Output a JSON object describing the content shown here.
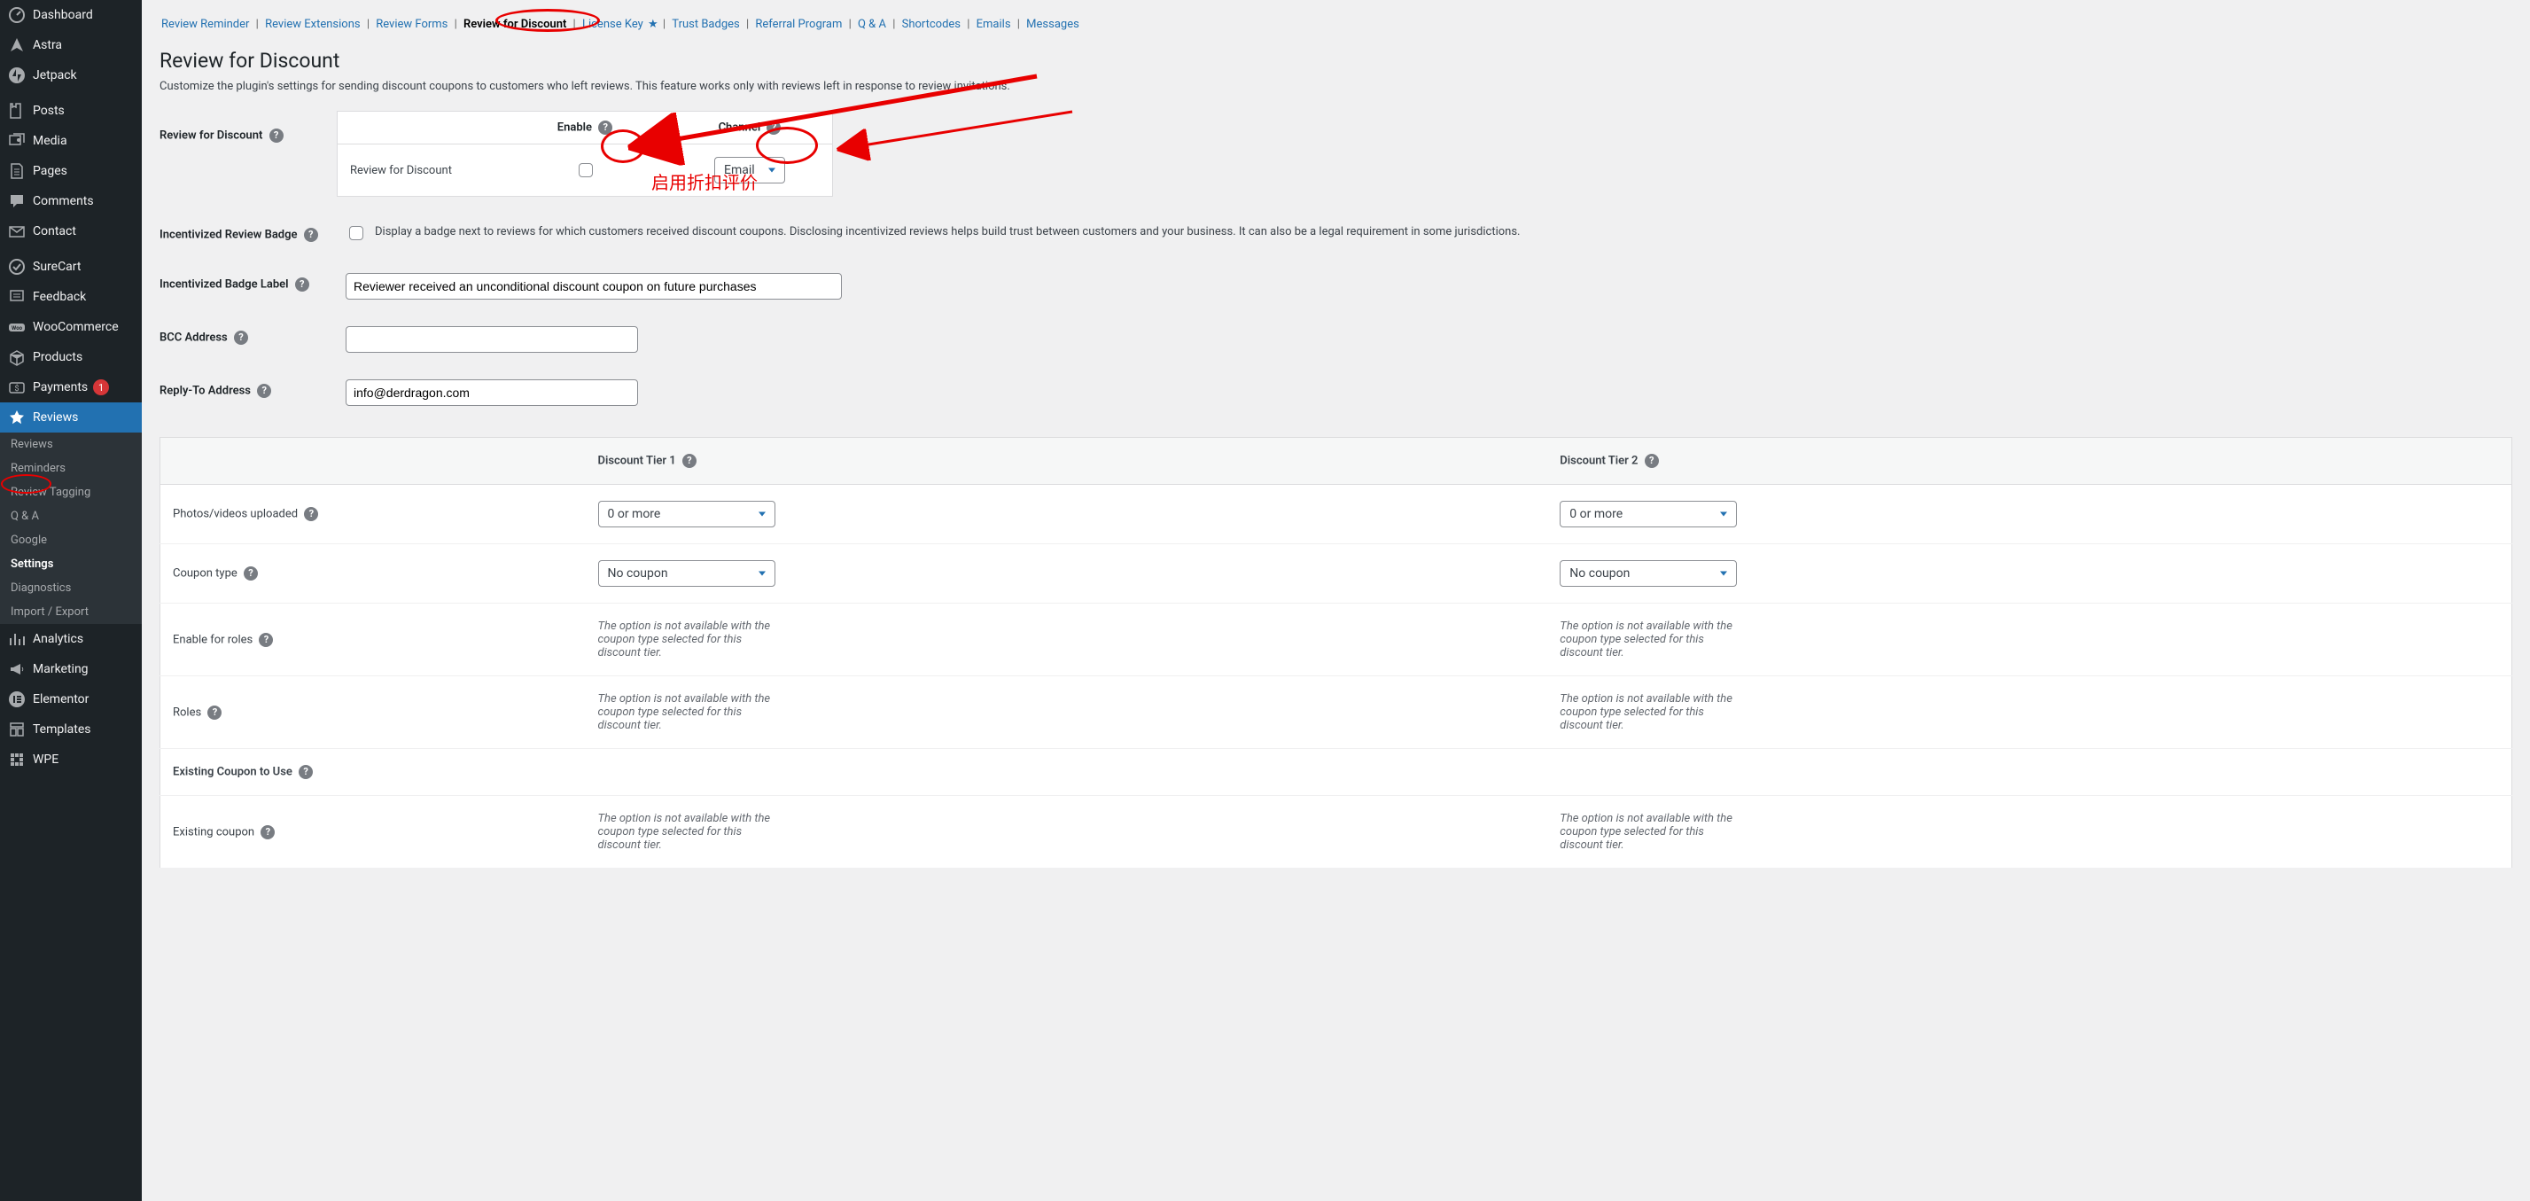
{
  "sidebar": {
    "items": [
      {
        "icon": "dashboard",
        "label": "Dashboard"
      },
      {
        "icon": "astra",
        "label": "Astra"
      },
      {
        "icon": "jetpack",
        "label": "Jetpack"
      },
      {
        "icon": "posts",
        "label": "Posts"
      },
      {
        "icon": "media",
        "label": "Media"
      },
      {
        "icon": "pages",
        "label": "Pages"
      },
      {
        "icon": "comments",
        "label": "Comments"
      },
      {
        "icon": "contact",
        "label": "Contact"
      },
      {
        "icon": "surecart",
        "label": "SureCart"
      },
      {
        "icon": "feedback",
        "label": "Feedback"
      },
      {
        "icon": "woo",
        "label": "WooCommerce"
      },
      {
        "icon": "products",
        "label": "Products"
      },
      {
        "icon": "payments",
        "label": "Payments",
        "badge": "1"
      },
      {
        "icon": "reviews",
        "label": "Reviews",
        "active": true
      },
      {
        "icon": "analytics",
        "label": "Analytics"
      },
      {
        "icon": "marketing",
        "label": "Marketing"
      },
      {
        "icon": "elementor",
        "label": "Elementor"
      },
      {
        "icon": "templates",
        "label": "Templates"
      },
      {
        "icon": "wpe",
        "label": "WPE"
      }
    ],
    "sub": [
      "Reviews",
      "Reminders",
      "Review Tagging",
      "Q & A",
      "Google",
      "Settings",
      "Diagnostics",
      "Import / Export"
    ],
    "sub_current": "Settings"
  },
  "tabs": [
    "Review Reminder",
    "Review Extensions",
    "Review Forms",
    "Review for Discount",
    "License Key",
    "Trust Badges",
    "Referral Program",
    "Q & A",
    "Shortcodes",
    "Emails",
    "Messages"
  ],
  "tabs_active": "Review for Discount",
  "tabs_star": "License Key",
  "page": {
    "title": "Review for Discount",
    "desc": "Customize the plugin's settings for sending discount coupons to customers who left reviews. This feature works only with reviews left in response to review invitations."
  },
  "row_rfd": {
    "label": "Review for Discount",
    "col_enable": "Enable",
    "col_channel": "Channel",
    "inner_label": "Review for Discount",
    "channel_value": "Email"
  },
  "row_badge": {
    "label": "Incentivized Review Badge",
    "checkbox_label": "Display a badge next to reviews for which customers received discount coupons. Disclosing incentivized reviews helps build trust between customers and your business. It can also be a legal requirement in some jurisdictions."
  },
  "row_badge_label": {
    "label": "Incentivized Badge Label",
    "value": "Reviewer received an unconditional discount coupon on future purchases"
  },
  "row_bcc": {
    "label": "BCC Address",
    "value": ""
  },
  "row_reply": {
    "label": "Reply-To Address",
    "value": "info@derdragon.com"
  },
  "tier_table": {
    "head_tier1": "Discount Tier 1",
    "head_tier2": "Discount Tier 2",
    "rows": [
      {
        "label": "Photos/videos uploaded",
        "type": "select",
        "v1": "0 or more",
        "v2": "0 or more"
      },
      {
        "label": "Coupon type",
        "type": "select",
        "v1": "No coupon",
        "v2": "No coupon"
      },
      {
        "label": "Enable for roles",
        "type": "note",
        "v1": "The option is not available with the coupon type selected for this discount tier.",
        "v2": "The option is not available with the coupon type selected for this discount tier."
      },
      {
        "label": "Roles",
        "type": "note",
        "v1": "The option is not available with the coupon type selected for this discount tier.",
        "v2": "The option is not available with the coupon type selected for this discount tier."
      }
    ],
    "section_label": "Existing Coupon to Use",
    "row_existing": {
      "label": "Existing coupon",
      "type": "note",
      "v1": "The option is not available with the coupon type selected for this discount tier.",
      "v2": "The option is not available with the coupon type selected for this discount tier."
    }
  },
  "annotations": {
    "chinese": "启用折扣评价"
  }
}
